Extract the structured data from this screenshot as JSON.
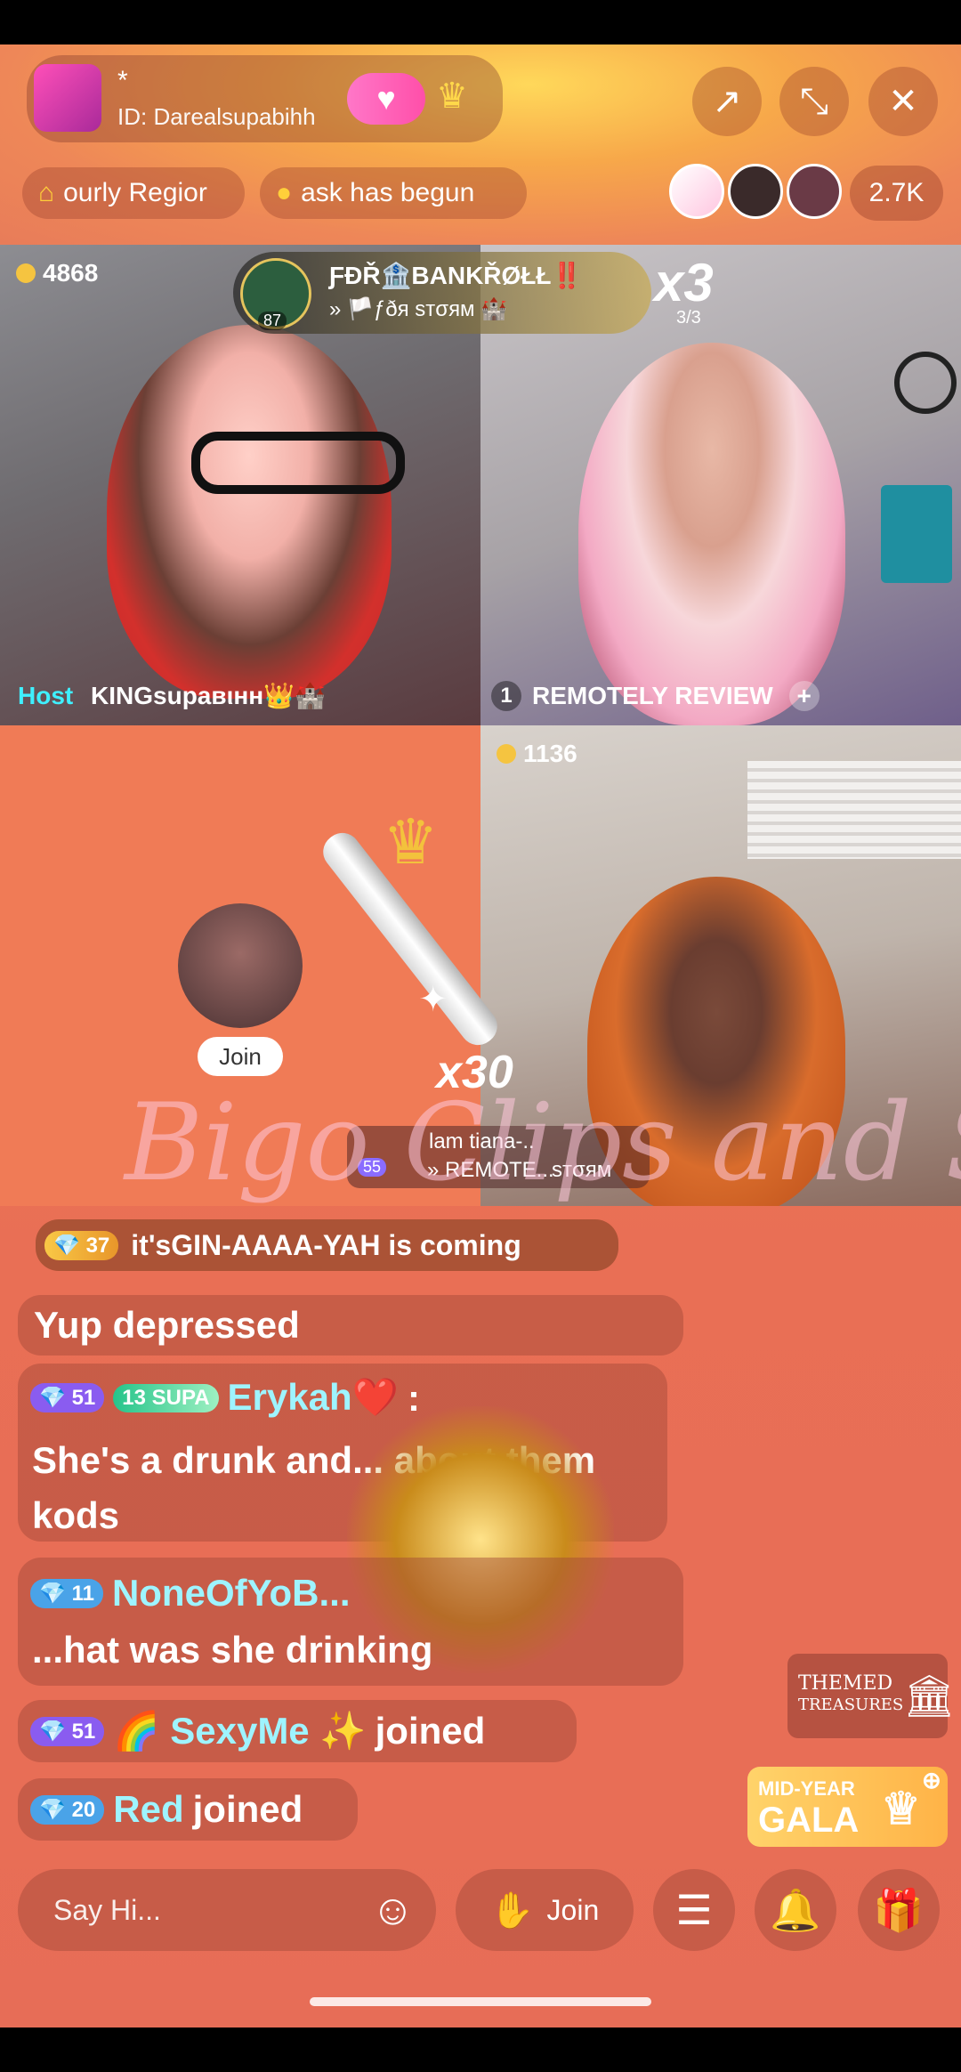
{
  "header": {
    "host_name": "*",
    "host_id": "ID: Darealsupabihh",
    "viewer_count": "2.7K"
  },
  "chips": {
    "region": "ourly Regior",
    "task": "ask has begun"
  },
  "tiles": {
    "t1": {
      "coins": "4868",
      "host_tag": "Host",
      "name": "KINGsupaвιнн👑🏰"
    },
    "t2": {
      "seat": "1",
      "name": "REMOTELY REVIEW"
    },
    "t3": {
      "join": "Join"
    },
    "t4": {
      "coins": "1136"
    }
  },
  "banner": {
    "title": "ƑÐŘ🏦BANKŘØŁŁ‼️",
    "subtitle": "» 🏳️ƒðя sтσям 🏰",
    "avatar_level": "87",
    "multiplier": "x3",
    "multiplier_sub": "3/3"
  },
  "gift": {
    "combo": "x30",
    "sender": "lam tiana-..",
    "level": "55",
    "receiver": "» REMOTE...",
    "receiver2": "sтσям",
    "watermark": "Bigo Clips and Sip"
  },
  "chat": [
    {
      "level": "37",
      "text": "it'sGIN-AAAA-YAH is coming"
    },
    {
      "text": "Yup depressed"
    },
    {
      "level": "51",
      "tag_level": "13",
      "tag": "SUPA",
      "name": "Erykah❤️",
      "suffix": ":",
      "message": "She's a drunk and... about them kods"
    },
    {
      "level": "11",
      "name": "NoneOfYoB...",
      "message": "...hat was she drinking"
    },
    {
      "level": "51",
      "name": "🌈 SexyMe ✨",
      "suffix": "joined"
    },
    {
      "level": "20",
      "name": "Red",
      "suffix": "joined"
    }
  ],
  "badges": {
    "themed_line1": "THEMED",
    "themed_line2": "TREASURES",
    "gala_line1": "MID-YEAR",
    "gala_line2": "GALA"
  },
  "bottom": {
    "say_hi": "Say Hi...",
    "join": "Join"
  }
}
